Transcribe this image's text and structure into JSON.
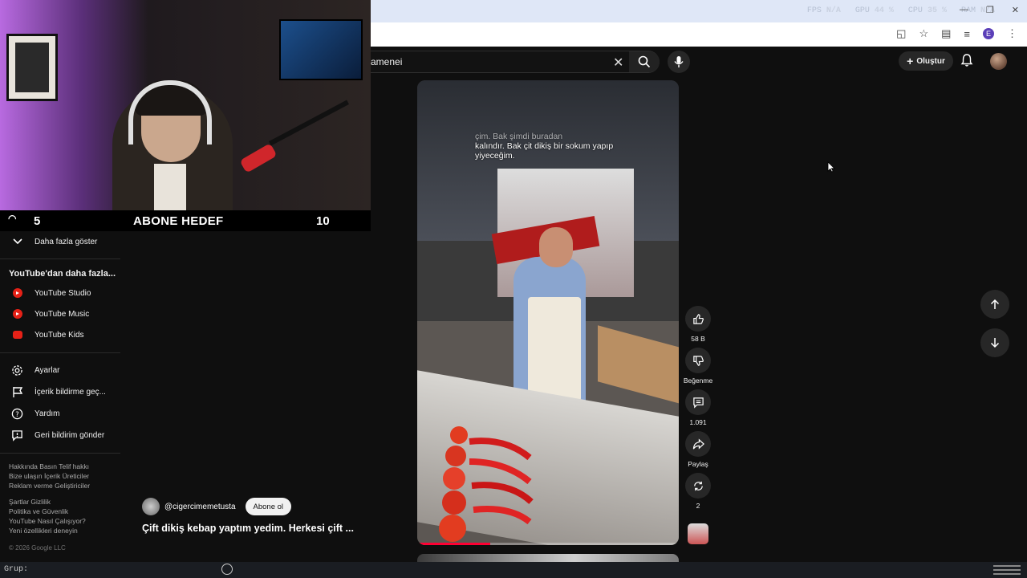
{
  "system_stats": [
    {
      "label": "FPS",
      "value": "N/A"
    },
    {
      "label": "GPU",
      "value": "44 %"
    },
    {
      "label": "CPU",
      "value": "35 %"
    },
    {
      "label": "RAM",
      "value": "N/A"
    }
  ],
  "browser": {
    "profile_initial": "E"
  },
  "header": {
    "search_query": "amenei",
    "create_label": "Oluştur"
  },
  "stream_overlay": {
    "goal_current": "5",
    "goal_title": "ABONE HEDEF",
    "goal_target": "10"
  },
  "sidebar": {
    "show_more": "Daha fazla göster",
    "more_from_youtube_title": "YouTube'dan daha fazla...",
    "youtube_items": [
      {
        "label": "YouTube Studio",
        "icon": "youtube-studio-icon"
      },
      {
        "label": "YouTube Music",
        "icon": "youtube-music-icon"
      },
      {
        "label": "YouTube Kids",
        "icon": "youtube-kids-icon"
      }
    ],
    "settings_items": [
      {
        "label": "Ayarlar",
        "icon": "gear-icon"
      },
      {
        "label": "İçerik bildirme geç...",
        "icon": "flag-icon"
      },
      {
        "label": "Yardım",
        "icon": "help-icon"
      },
      {
        "label": "Geri bildirim gönder",
        "icon": "feedback-icon"
      }
    ],
    "footer_line1": "Hakkında  Basın  Telif hakkı",
    "footer_line2": "Bize ulaşın  İçerik Üreticiler",
    "footer_line3": "Reklam verme  Geliştiriciler",
    "footer_line4": "Şartlar  Gizlilik",
    "footer_line5": "Politika ve Güvenlik",
    "footer_line6": "YouTube Nasıl Çalışıyor?",
    "footer_line7": "Yeni özellikleri deneyin",
    "copyright": "© 2026 Google LLC"
  },
  "short": {
    "caption": "Bak çit dikiş bir sokum yapıp yiyeceğim.",
    "caption_line_a": "çim. Bak şimdi buradan",
    "caption_line_b": "kalındır. Bak çit dikiş bir sokum yapıp",
    "caption_line_c": "yiyeceğim.",
    "channel": "@cigercimemetusta",
    "subscribe_label": "Abone ol",
    "title": "Çift dikiş kebap yaptım yedim. Herkesi çift ...",
    "progress": 0.28,
    "likes": "58 B",
    "dislike_label": "Beğenme",
    "comments": "1.091",
    "share_label": "Paylaş",
    "remix_count": "2"
  },
  "taskbar": {
    "group_label": "Grup:"
  }
}
